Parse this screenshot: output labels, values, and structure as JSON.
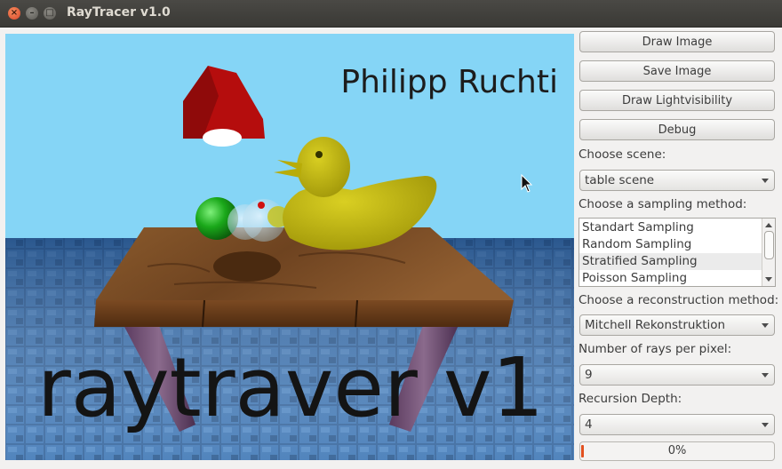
{
  "window": {
    "title": "RayTracer v1.0",
    "controls": {
      "close": "×",
      "minimize": "–",
      "maximize": "□"
    }
  },
  "render": {
    "author_text": "Philipp Ruchti",
    "overlay_text": "raytraver v1"
  },
  "panel": {
    "buttons": {
      "draw_image": "Draw Image",
      "save_image": "Save Image",
      "draw_lightvisibility": "Draw Lightvisibility",
      "debug": "Debug"
    },
    "scene": {
      "label": "Choose scene:",
      "value": "table scene"
    },
    "sampling": {
      "label": "Choose a sampling method:",
      "options": [
        "Standart Sampling",
        "Random Sampling",
        "Stratified Sampling",
        "Poisson Sampling"
      ],
      "selected": "Stratified Sampling"
    },
    "reconstruction": {
      "label": "Choose a reconstruction method:",
      "value": "Mitchell Rekonstruktion"
    },
    "rays": {
      "label": "Number of rays per pixel:",
      "value": "9"
    },
    "recursion": {
      "label": "Recursion Depth:",
      "value": "4"
    },
    "progress": {
      "value": 0,
      "text": "0%"
    }
  },
  "colors": {
    "accent": "#e2501f",
    "sky": "#85d5f6",
    "tile": "#2a5c94",
    "table": "#6b3b1a",
    "duck": "#bdb30a",
    "lamp": "#b50d0d"
  }
}
